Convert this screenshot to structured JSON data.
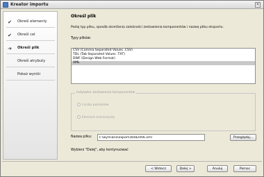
{
  "window": {
    "title": "Kreator importu"
  },
  "steps": [
    {
      "label": "Określ elementy",
      "state": "done"
    },
    {
      "label": "Określ cel",
      "state": "done"
    },
    {
      "label": "Określ plik",
      "state": "current"
    },
    {
      "label": "Określ atrybuty",
      "state": "pending"
    },
    {
      "label": "Pokaż wyniki",
      "state": "pending"
    }
  ],
  "content": {
    "heading": "Określ plik",
    "description": "Podaj typ pliku, sposób określania zależności zestawienia komponentów i nazwę pliku eksportu.",
    "file_types_label": "Typy plików:",
    "file_types": [
      "CSV (Comma Separated Values .CSV)",
      "TDL (Tab Separated Values .TXT)",
      "DWF (Design Web Format)",
      "XML"
    ],
    "selected_file_type": "XML",
    "bom_group": {
      "legend": "Indykator zestawienia komponentów",
      "options": [
        "Liczba poziomów",
        "Element macierzysty"
      ],
      "selected": "Liczba poziomów",
      "enabled": false
    },
    "filename_label": "Nazwa pliku:",
    "filename_value": "F:\\wymiana\\export16082006.xml",
    "browse_label": "Przeglądaj...",
    "hint": "Wybierz \"Dalej\", aby kontynuować"
  },
  "buttons": {
    "back": "< Wstecz",
    "next": "Dalej >",
    "cancel": "Anuluj",
    "help": "Pomoc"
  }
}
